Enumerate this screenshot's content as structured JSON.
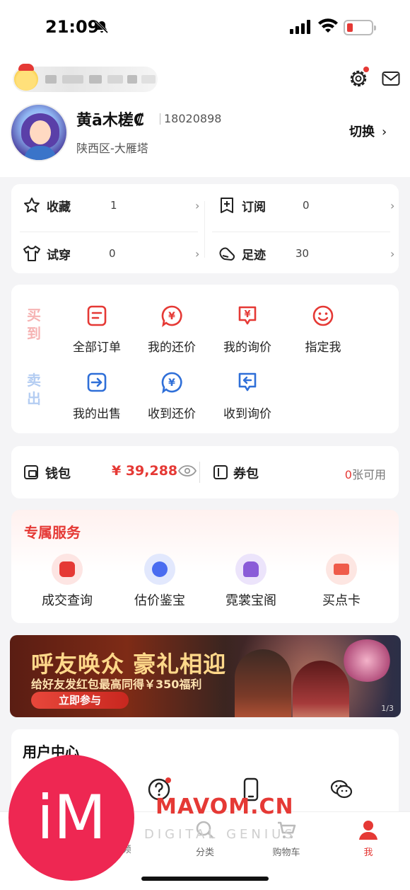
{
  "status_bar": {
    "time": "21:09"
  },
  "header": {
    "username": "黄ā木槎₡",
    "uid": "18020898",
    "location": "陕西区-大雁塔",
    "switch_label": "切换",
    "switch_chevron": "›"
  },
  "quick_links": [
    {
      "label": "收藏",
      "count": "1",
      "icon": "star-icon"
    },
    {
      "label": "订阅",
      "count": "0",
      "icon": "subscribe-icon"
    },
    {
      "label": "试穿",
      "count": "0",
      "icon": "shirt-icon"
    },
    {
      "label": "足迹",
      "count": "30",
      "icon": "footprint-icon"
    }
  ],
  "orders": {
    "buy_label": "买到",
    "sell_label": "卖出",
    "buy_items": [
      {
        "label": "全部订单",
        "icon": "order-list-icon"
      },
      {
        "label": "我的还价",
        "icon": "counter-offer-icon"
      },
      {
        "label": "我的询价",
        "icon": "inquiry-icon"
      },
      {
        "label": "指定我",
        "icon": "smiley-icon"
      }
    ],
    "sell_items": [
      {
        "label": "我的出售",
        "icon": "sell-arrow-icon"
      },
      {
        "label": "收到还价",
        "icon": "received-offer-icon"
      },
      {
        "label": "收到询价",
        "icon": "received-inquiry-icon"
      }
    ]
  },
  "wallet": {
    "wallet_label": "钱包",
    "amount": "¥ 39,288",
    "coupon_label": "券包",
    "coupon_count": "0",
    "coupon_suffix": "张可用"
  },
  "services": {
    "title": "专属服务",
    "items": [
      {
        "label": "成交查询",
        "icon": "deal-query-icon",
        "color": "#e53935"
      },
      {
        "label": "估价鉴宝",
        "icon": "appraise-icon",
        "color": "#4a6cf0"
      },
      {
        "label": "霓裳宝阁",
        "icon": "wardrobe-icon",
        "color": "#8a5cd8"
      },
      {
        "label": "买点卡",
        "icon": "card-icon",
        "color": "#ef5b4a"
      }
    ]
  },
  "banner": {
    "title": "呼友唤众 豪礼相迎",
    "subtitle": "给好友发红包最高同得￥350福利",
    "button": "立即参与",
    "page": "1/3"
  },
  "user_center": {
    "title": "用户中心"
  },
  "tabbar": [
    {
      "label": "频",
      "icon": "video-icon"
    },
    {
      "label": "分类",
      "icon": "category-icon"
    },
    {
      "label": "购物车",
      "icon": "cart-icon"
    },
    {
      "label": "我",
      "icon": "profile-icon"
    }
  ],
  "watermark": {
    "logo_text": "iM",
    "site": "MAVOM.CN",
    "tagline": "DIGITAL GENIUS"
  },
  "colors": {
    "accent": "#e53935",
    "blue": "#2f6fd8",
    "background": "#f4f4f6"
  }
}
